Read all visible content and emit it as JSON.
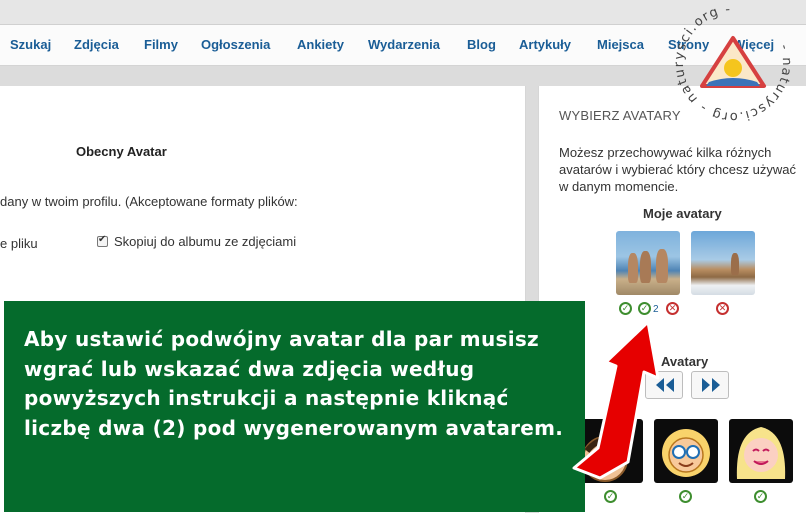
{
  "nav": {
    "items": [
      "Szukaj",
      "Zdjęcia",
      "Filmy",
      "Ogłoszenia",
      "Ankiety",
      "Wydarzenia",
      "Blog",
      "Artykuły",
      "Miejsca",
      "Strony",
      "Więcej"
    ]
  },
  "main": {
    "title": "Obecny Avatar",
    "info_line": "dany w twoim profilu. (Akceptowane formaty plików:",
    "file_label": "e pliku",
    "copy_checkbox_label": "Skopiuj do albumu ze zdjęciami",
    "copy_checked": true
  },
  "sidebar": {
    "heading": "WYBIERZ AVATARY",
    "description": "Możesz przechowywać kilka różnych avatarów i wybierać który chcesz używać w danym momencie.",
    "my_avatars_label": "Moje avatary",
    "pair_number": "2",
    "avatars_label": "Avatary"
  },
  "watermark": {
    "text": "- naturysci.org - naturysci.org -"
  },
  "banner": {
    "text": "Aby ustawić podwójny avatar dla par musisz wgrać lub wskazać dwa zdjęcia według powyższych instrukcji a następnie kliknąć liczbę dwa (2) pod wygenerowanym avatarem."
  },
  "icons": {
    "select": "check-circle-icon",
    "delete": "x-circle-icon",
    "prev": "double-chevron-left-icon",
    "next": "double-chevron-right-icon"
  },
  "colors": {
    "nav_text": "#1a5d96",
    "banner_bg": "#056b2c",
    "ok": "#3e8e2f",
    "delete": "#c53030",
    "arrow": "#e60000"
  }
}
